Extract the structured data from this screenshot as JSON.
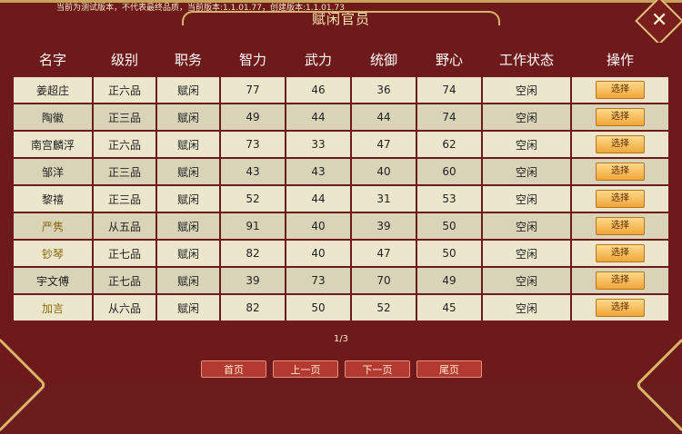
{
  "version_text": "当前为测试版本，不代表最终品质，当前版本:1.1.01.77，创建版本:1.1.01.73",
  "title": "赋闲官员",
  "close_label": "✕",
  "columns": [
    "名字",
    "级别",
    "职务",
    "智力",
    "武力",
    "统御",
    "野心",
    "工作状态",
    "操作"
  ],
  "select_label": "选择",
  "rows": [
    {
      "name": "姜超庄",
      "rank": "正六品",
      "post": "赋闲",
      "int": "77",
      "str": "46",
      "lead": "36",
      "amb": "74",
      "status": "空闲",
      "gold": false
    },
    {
      "name": "陶徽",
      "rank": "正三品",
      "post": "赋闲",
      "int": "49",
      "str": "44",
      "lead": "44",
      "amb": "74",
      "status": "空闲",
      "gold": false
    },
    {
      "name": "南宫麟浮",
      "rank": "正六品",
      "post": "赋闲",
      "int": "73",
      "str": "33",
      "lead": "47",
      "amb": "62",
      "status": "空闲",
      "gold": false
    },
    {
      "name": "邹洋",
      "rank": "正三品",
      "post": "赋闲",
      "int": "43",
      "str": "43",
      "lead": "40",
      "amb": "60",
      "status": "空闲",
      "gold": false
    },
    {
      "name": "黎禧",
      "rank": "正三品",
      "post": "赋闲",
      "int": "52",
      "str": "44",
      "lead": "31",
      "amb": "53",
      "status": "空闲",
      "gold": false
    },
    {
      "name": "严隽",
      "rank": "从五品",
      "post": "赋闲",
      "int": "91",
      "str": "40",
      "lead": "39",
      "amb": "50",
      "status": "空闲",
      "gold": true
    },
    {
      "name": "钞琴",
      "rank": "正七品",
      "post": "赋闲",
      "int": "82",
      "str": "40",
      "lead": "47",
      "amb": "50",
      "status": "空闲",
      "gold": true
    },
    {
      "name": "宇文傅",
      "rank": "正七品",
      "post": "赋闲",
      "int": "39",
      "str": "73",
      "lead": "70",
      "amb": "49",
      "status": "空闲",
      "gold": false
    },
    {
      "name": "加言",
      "rank": "从六品",
      "post": "赋闲",
      "int": "82",
      "str": "50",
      "lead": "52",
      "amb": "45",
      "status": "空闲",
      "gold": true
    }
  ],
  "page_indicator": "1/3",
  "pager_buttons": [
    "首页",
    "上一页",
    "下一页",
    "尾页"
  ]
}
